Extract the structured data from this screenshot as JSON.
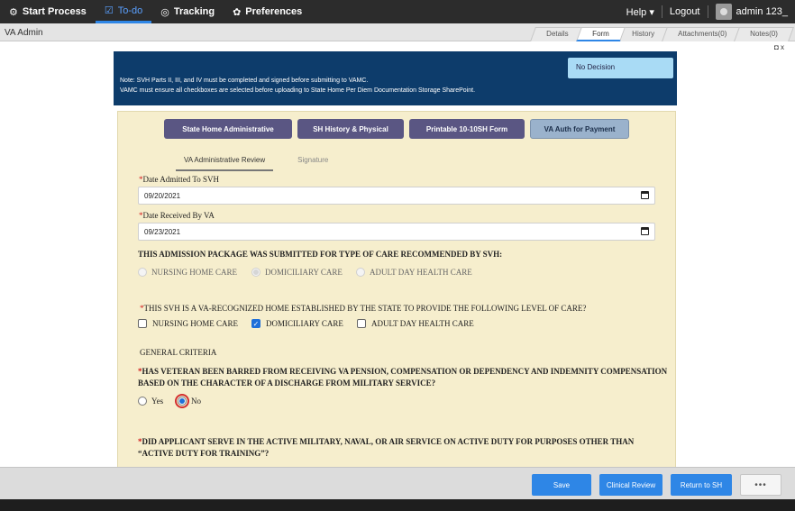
{
  "topnav": {
    "start_process": "Start Process",
    "todo": "To-do",
    "tracking": "Tracking",
    "preferences": "Preferences",
    "help": "Help ▾",
    "logout": "Logout",
    "user": "admin 123_"
  },
  "subbar": {
    "title": "VA Admin",
    "tabs": [
      "Details",
      "Form",
      "History",
      "Attachments(0)",
      "Notes(0)"
    ],
    "active_tab": "Form",
    "close_label": "◘ x"
  },
  "note": {
    "line1": "Note: SVH Parts II, III, and IV must be completed and signed before submitting to VAMC.",
    "line2": "VAMC must ensure all checkboxes are selected before uploading to State Home Per Diem Documentation Storage SharePoint.",
    "decision": "No Decision"
  },
  "section_tabs": [
    "State Home Administrative",
    "SH History & Physical",
    "Printable 10-10SH Form",
    "VA Auth for Payment"
  ],
  "active_section_tab": "VA Auth for Payment",
  "sub_tabs": [
    "VA Administrative Review",
    "Signature"
  ],
  "active_sub_tab": "VA Administrative Review",
  "fields": {
    "date_admitted_label": "Date Admitted To SVH",
    "date_admitted_value": "09/20/2021",
    "date_received_label": "Date Received By VA",
    "date_received_value": "09/23/2021"
  },
  "care_type": {
    "question": "THIS ADMISSION PACKAGE WAS SUBMITTED FOR TYPE OF CARE RECOMMENDED BY SVH:",
    "options": [
      "NURSING HOME CARE",
      "DOMICILIARY CARE",
      "ADULT DAY HEALTH CARE"
    ],
    "selected": "DOMICILIARY CARE"
  },
  "recognized": {
    "question": "THIS SVH IS A VA-RECOGNIZED HOME ESTABLISHED BY THE STATE TO PROVIDE THE FOLLOWING LEVEL OF CARE?",
    "options": [
      "NURSING HOME CARE",
      "DOMICILIARY CARE",
      "ADULT DAY HEALTH CARE"
    ],
    "checked": [
      "DOMICILIARY CARE"
    ]
  },
  "general_criteria": "GENERAL CRITERIA",
  "barred": {
    "question": "HAS VETERAN BEEN BARRED FROM RECEIVING VA PENSION, COMPENSATION OR DEPENDENCY AND INDEMNITY COMPENSATION BASED ON THE CHARACTER OF A DISCHARGE FROM MILITARY SERVICE?",
    "options": [
      "Yes",
      "No"
    ],
    "selected": "No"
  },
  "active_service": {
    "question": "DID APPLICANT SERVE IN THE ACTIVE MILITARY, NAVAL, OR AIR SERVICE ON ACTIVE DUTY FOR PURPOSES OTHER THAN “ACTIVE DUTY FOR TRAINING”?"
  },
  "buttons": {
    "save": "Save",
    "clinical_review": "Clinical Review",
    "return_to_sh": "Return to SH",
    "more": "•••"
  },
  "colors": {
    "accent": "#2e86e6",
    "note_bg": "#0d3c6b",
    "form_bg": "#f6eecd",
    "section_tab": "#5a5683",
    "required": "#d21a1a"
  }
}
